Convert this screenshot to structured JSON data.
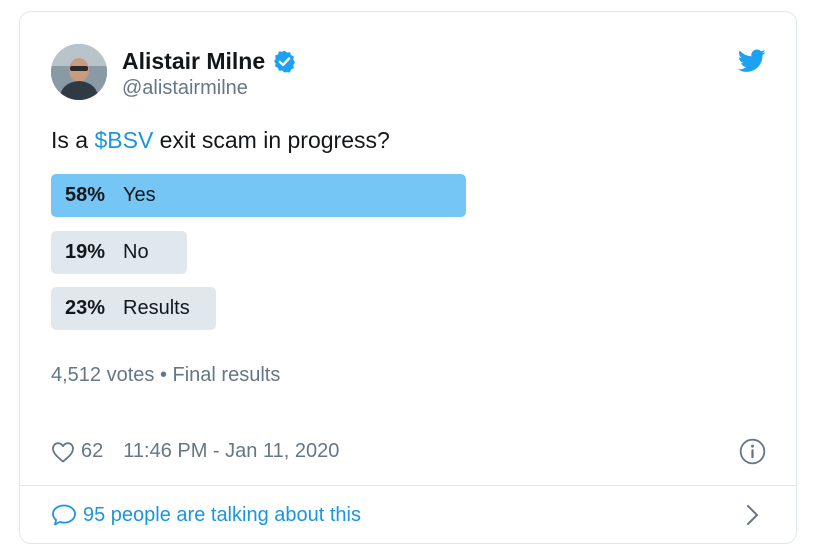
{
  "author": {
    "name": "Alistair Milne",
    "handle": "@alistairmilne"
  },
  "tweet": {
    "question_prefix": "Is a ",
    "question_tag": "$BSV",
    "question_suffix": " exit scam in progress?"
  },
  "poll": {
    "options": [
      {
        "percent": "58%",
        "label": "Yes",
        "fraction": 0.58,
        "winner": true
      },
      {
        "percent": "19%",
        "label": "No",
        "fraction": 0.19,
        "winner": false
      },
      {
        "percent": "23%",
        "label": "Results",
        "fraction": 0.23,
        "winner": false
      }
    ],
    "summary": "4,512 votes • Final results"
  },
  "stats": {
    "likes": "62",
    "timestamp": "11:46 PM - Jan 11, 2020"
  },
  "conversation": {
    "label": "95 people are talking about this"
  },
  "icons": {
    "verified": "verified-badge-icon",
    "twitter": "twitter-bird-icon",
    "like": "heart-icon",
    "info": "info-icon",
    "reply": "speech-bubble-icon",
    "chevron": "chevron-right-icon"
  },
  "colors": {
    "accent": "#1b95e0",
    "winner_bar": "#75c6f5",
    "other_bar": "#e1e8ed"
  }
}
